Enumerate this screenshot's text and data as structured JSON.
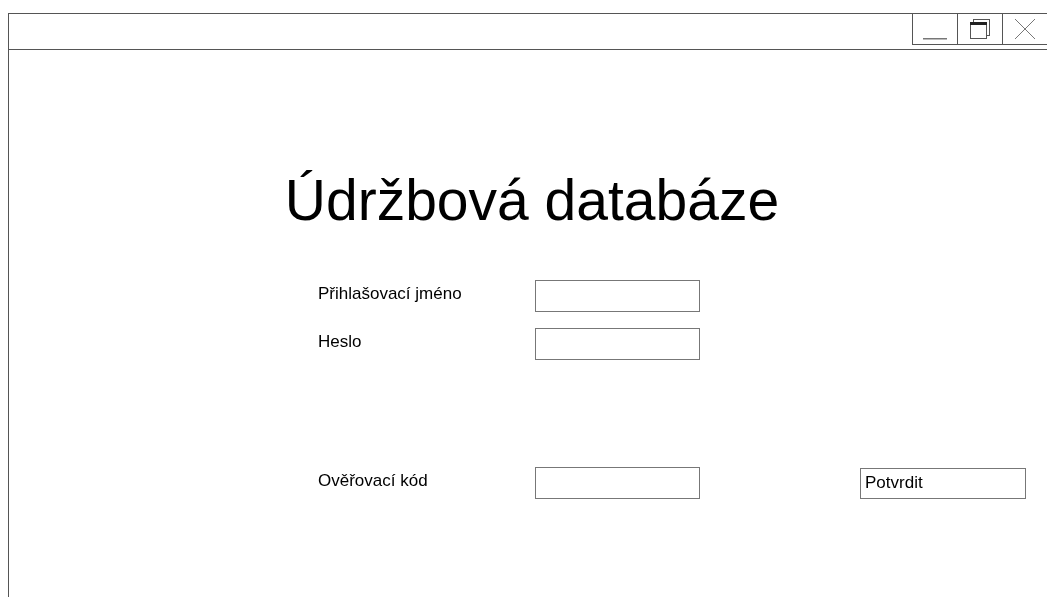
{
  "heading": "Údržbová databáze",
  "fields": [
    {
      "label": "Přihlašovací jméno"
    },
    {
      "label": "Heslo"
    }
  ],
  "verification": {
    "label": "Ověřovací kód"
  },
  "buttons": [
    "Potvrdit"
  ]
}
